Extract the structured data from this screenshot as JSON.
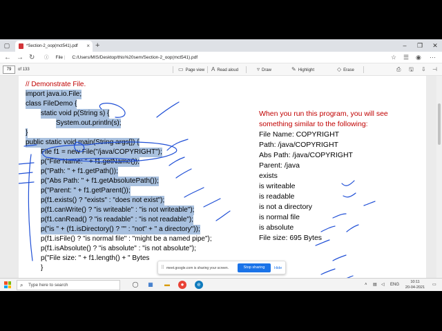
{
  "browser": {
    "tab_title": "*Section-2_oop(mct541).pdf",
    "tab_close": "×",
    "new_tab": "+",
    "url_info": "File",
    "url": "C:/Users/MIS/Desktop/this%20sem/Section-2_oop(mct541).pdf"
  },
  "pdf_toolbar": {
    "page_current": "79",
    "page_total": "of 133",
    "page_view": "Page view",
    "read_aloud": "Read aloud",
    "draw": "Draw",
    "highlight": "Highlight",
    "erase": "Erase"
  },
  "code": {
    "comment": "// Demonstrate File.",
    "lines": [
      "import java.io.File;",
      "class FileDemo {",
      "static void p(String s) {",
      "System.out.println(s);",
      "}",
      "public static void main(String args[]) {",
      "File f1 = new File(\"/java/COPYRIGHT\");",
      "p(\"File Name: \" + f1.getName());",
      "p(\"Path: \" + f1.getPath());",
      "p(\"Abs Path: \" + f1.getAbsolutePath());",
      "p(\"Parent: \" + f1.getParent());",
      "p(f1.exists() ? \"exists\" : \"does not exist\");",
      "p(f1.canWrite() ? \"is writeable\" : \"is not writeable\");",
      "p(f1.canRead() ? \"is readable\" : \"is not readable\");",
      "p(\"is \" + (f1.isDirectory() ? \"\" : \"not\" + \" a directory\"));",
      "p(f1.isFile() ? \"is normal file\" : \"might be a named pipe\");",
      "p(f1.isAbsolute() ? \"is absolute\" : \"is not absolute\");",
      "p(\"File size: \" + f1.length() + \" Bytes"
    ]
  },
  "output": {
    "intro_1": "When you run this program, you will see",
    "intro_2": "something similar to the following:",
    "lines": [
      "File Name: COPYRIGHT",
      "Path: /java/COPYRIGHT",
      "Abs Path: /java/COPYRIGHT",
      "Parent: /java",
      "exists",
      "is writeable",
      "is readable",
      "is not a directory",
      "is normal file",
      "is absolute",
      "File size: 695 Bytes"
    ]
  },
  "share_banner": {
    "message": "meet.google.com is sharing your screen.",
    "stop": "Stop sharing",
    "hide": "Hide"
  },
  "taskbar": {
    "search_placeholder": "Type here to search",
    "language": "ENG",
    "time": "10:11",
    "date": "20-04-2021"
  },
  "colors": {
    "comment_red": "#c00000",
    "highlight_blue": "#a9c1df",
    "ink_blue": "#1f4fd6",
    "accent": "#1a73e8"
  }
}
